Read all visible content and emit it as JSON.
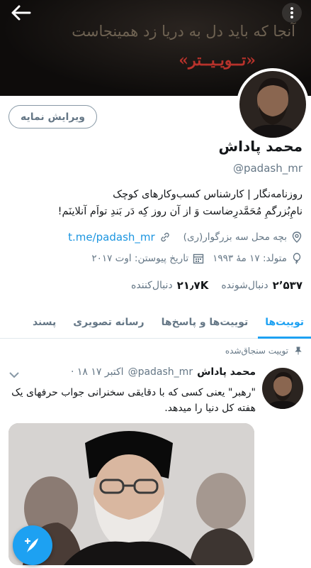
{
  "header": {
    "banner_line1": "آنجا كه بايد دل به دريا زد همينجاست",
    "banner_line2": "«تــويـيــتر»",
    "back_icon": "arrow-left-icon",
    "more_icon": "more-vertical-icon"
  },
  "profile": {
    "edit_label": "ویرایش نمایه",
    "name": "محمد پاداش",
    "handle": "@padash_mr",
    "bio_line1": "روزنامه‌نگار | کارشناس کسب‌وکارهای کوچک",
    "bio_line2": "نامِ‌بُزرگمِ مُحَمَّدرِضاست وَ از آن روز كِه دَر بَندِ تو‌اَم آنلاينَم!",
    "location": "بچه محل سه بزرگوار(ری)",
    "link": "t.me/padash_mr",
    "birth": "متولد: ۱۷ مهٔ ۱۹۹۳",
    "joined": "تاریخ پیوستن: اوت ۲۰۱۷",
    "following_count": "۲٬۵۳۷",
    "following_label": "دنبال‌شونده",
    "followers_count": "۲۱٫۷K",
    "followers_label": "دنبال‌کننده"
  },
  "tabs": [
    {
      "label": "توییت‌ها",
      "active": true
    },
    {
      "label": "توییت‌ها و پاسخ‌ها",
      "active": false
    },
    {
      "label": "رسانه تصویری",
      "active": false
    },
    {
      "label": "پسند",
      "active": false
    }
  ],
  "tweet": {
    "pinned_label": "توییت سنجاق‌شده",
    "author": "محمد پاداش",
    "handle": "@padash_mr",
    "date": "· ۱۸ اکتبر ۱۷",
    "text": "\"رهبر\" یعنی کسی که با دقایقی سخنرانی جواب حرفهای یک هفته کل دنیا را میدهد."
  },
  "colors": {
    "accent": "#1da1f2",
    "banner_red": "#b7322b"
  },
  "fab": {
    "icon": "compose-tweet-icon"
  }
}
